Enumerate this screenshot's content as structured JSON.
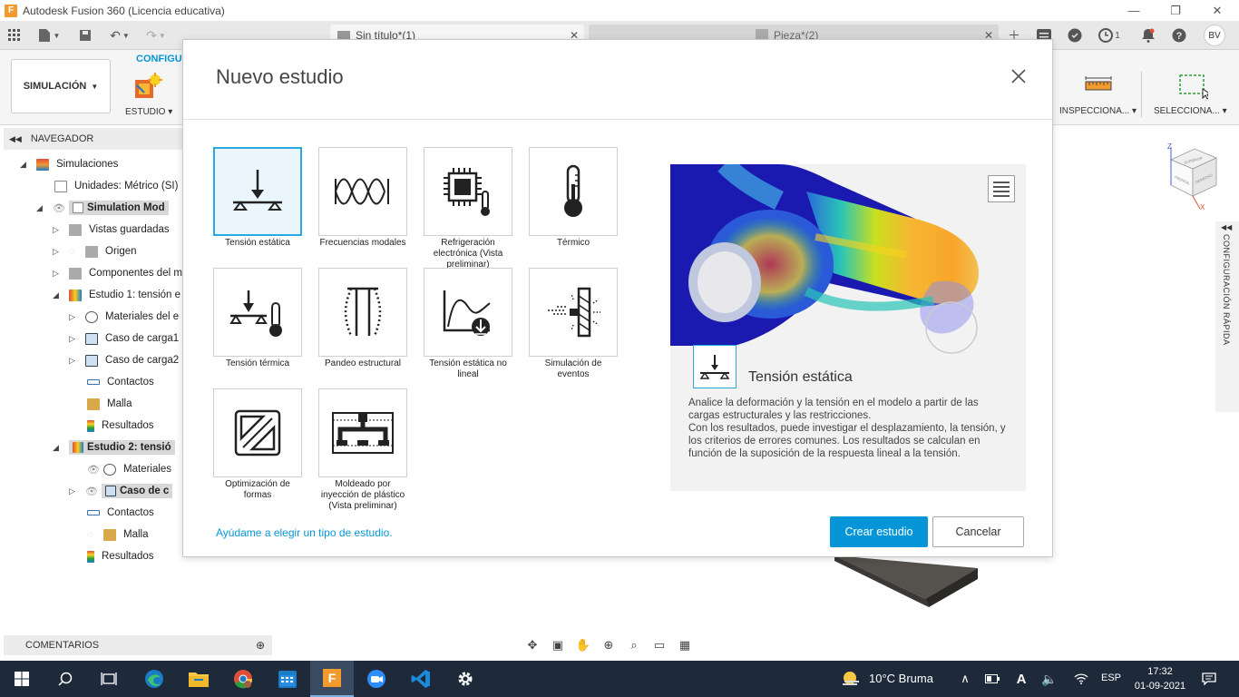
{
  "app": {
    "title": "Autodesk Fusion 360 (Licencia educativa)",
    "logo_letter": "F"
  },
  "tabs": [
    {
      "label": "Sin título*(1)",
      "active": true
    },
    {
      "label": "Pieza*(2)",
      "active": false
    }
  ],
  "topbar": {
    "job_count": "1",
    "user_initials": "BV"
  },
  "ribbon": {
    "workspace": "SIMULACIÓN",
    "tab_label": "CONFIGUR",
    "study_group": "ESTUDIO",
    "inspect_group": "INSPECCIONA...",
    "select_group": "SELECCIONA..."
  },
  "browser": {
    "header": "NAVEGADOR",
    "items": [
      {
        "label": "Simulaciones"
      },
      {
        "label": "Unidades: Métrico (SI)"
      },
      {
        "label": "Simulation Mod"
      },
      {
        "label": "Vistas guardadas"
      },
      {
        "label": "Origen"
      },
      {
        "label": "Componentes del m"
      },
      {
        "label": "Estudio 1: tensión e"
      },
      {
        "label": "Materiales del e"
      },
      {
        "label": "Caso de carga1"
      },
      {
        "label": "Caso de carga2"
      },
      {
        "label": "Contactos"
      },
      {
        "label": "Malla"
      },
      {
        "label": "Resultados"
      },
      {
        "label": "Estudio 2: tensió"
      },
      {
        "label": "Materiales"
      },
      {
        "label": "Caso de c"
      },
      {
        "label": "Contactos"
      },
      {
        "label": "Malla"
      },
      {
        "label": "Resultados"
      }
    ]
  },
  "comments": {
    "label": "COMENTARIOS"
  },
  "quick_setup": {
    "label": "CONFIGURACIÓN RÁPIDA"
  },
  "viewcube": {
    "axis_z": "Z",
    "axis_x": "X",
    "face_front": "FRONTAL",
    "face_right": "DERECHO",
    "face_top": "SUPERIOR"
  },
  "dialog": {
    "title": "Nuevo estudio",
    "help_link": "Ayúdame a elegir un tipo de estudio.",
    "create_button": "Crear estudio",
    "cancel_button": "Cancelar",
    "study_types": [
      {
        "label": "Tensión estática",
        "selected": true
      },
      {
        "label": "Frecuencias modales"
      },
      {
        "label": "Refrigeración electrónica (Vista preliminar)"
      },
      {
        "label": "Térmico"
      },
      {
        "label": "Tensión térmica"
      },
      {
        "label": "Pandeo estructural"
      },
      {
        "label": "Tensión estática no lineal"
      },
      {
        "label": "Simulación de eventos"
      },
      {
        "label": "Optimización de formas"
      },
      {
        "label": "Moldeado por inyección de plástico (Vista preliminar)"
      }
    ],
    "preview": {
      "title": "Tensión estática",
      "description": "Analice la deformación y la tensión en el modelo a partir de las cargas estructurales y las restricciones.\nCon los resultados, puede investigar el desplazamiento, la tensión, y los criterios de errores comunes. Los resultados se calculan en función de la suposición de la respuesta lineal a la tensión."
    }
  },
  "taskbar": {
    "weather": "10°C  Bruma",
    "language": "ESP",
    "time": "17:32",
    "date": "01-09-2021"
  },
  "colors": {
    "accent": "#0696d7",
    "taskbar": "#1e2a3a"
  }
}
